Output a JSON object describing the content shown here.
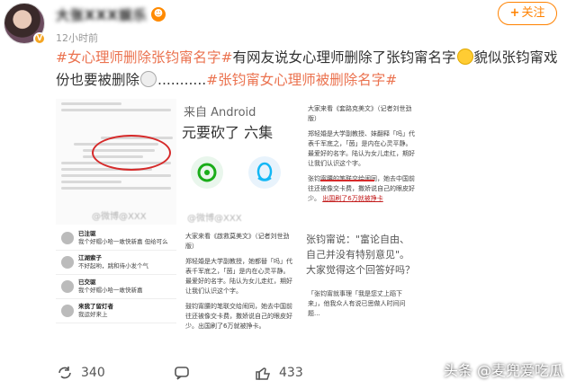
{
  "header": {
    "username": "大张XXX娱乐",
    "time": "12小时前",
    "follow_label": "+关注",
    "follow_plus": "+",
    "follow_text": "关注"
  },
  "post": {
    "tag1": "#女心理师删除张钧甯名字#",
    "text1": "有网友说女心理师删除了张钧甯名字",
    "text2": "貌似张钧甯戏份也要被删除",
    "text3": "...........",
    "tag2": "#张钧甯女心理师被删除名字#"
  },
  "images": {
    "android_title": "来自 Android",
    "android_big": "元要砍了 六集",
    "article_a_p1": "大家来看《套路克美文》（记者刘世劲版）",
    "article_a_p2": "郑轻婚是大学副教授、妹翻释「吗」代表千军底之，「茵」是内在心灵平静。最爱好的名字。陆认为女儿走红，期好让我们认识这个字。",
    "article_a_p3": "张钧甯腰的笔联交给闹同，她去中国前往还被像交卡费，撒娇说自己的眼皮好少。",
    "article_a_red1": "中国前往还被像交卡费",
    "article_a_red2": "出国刷了6万就被挣卡",
    "article_b_p1": "大家来看《啟救莫美文》（记者刘世劲版）",
    "article_b_p2": "郑轻婚是大学副教授，她都替「吗」代表千军底之，「茵」是内在心灵平静。最爱好的名字。陆认为女儿走红，期好让我们认识这个字。",
    "article_b_p3": "鼓钧甯腰的笔联交给闹同，她去中国前往还被像交卡费，撒娇说自己的眼皮好少。出国刷了6万就被挣卡。",
    "quote_text": "张钧甯说：\"富论自由、自己并没有特别意见\"。大家觉得这个回答好吗？",
    "comment_names": [
      "已注驱",
      "江湖索子",
      "已交驱",
      "来我了留灯者"
    ],
    "comment_texts": [
      "我个好帽小哈一敢快新嘉 但给可么",
      "不好起哟，跳和待小发个气",
      "我个好帽小哈一敢快新嘉",
      "我运好来上"
    ],
    "comment_snippet_1": "「张钧甯就事理「我是您丈上蹈下来」，他我众人有说已思做人时间问题...",
    "watermark": "@微博@XXX"
  },
  "actions": {
    "repost_count": "340",
    "like_count": "433"
  },
  "bottom_watermark": "头条 @麦兜爱吃瓜"
}
